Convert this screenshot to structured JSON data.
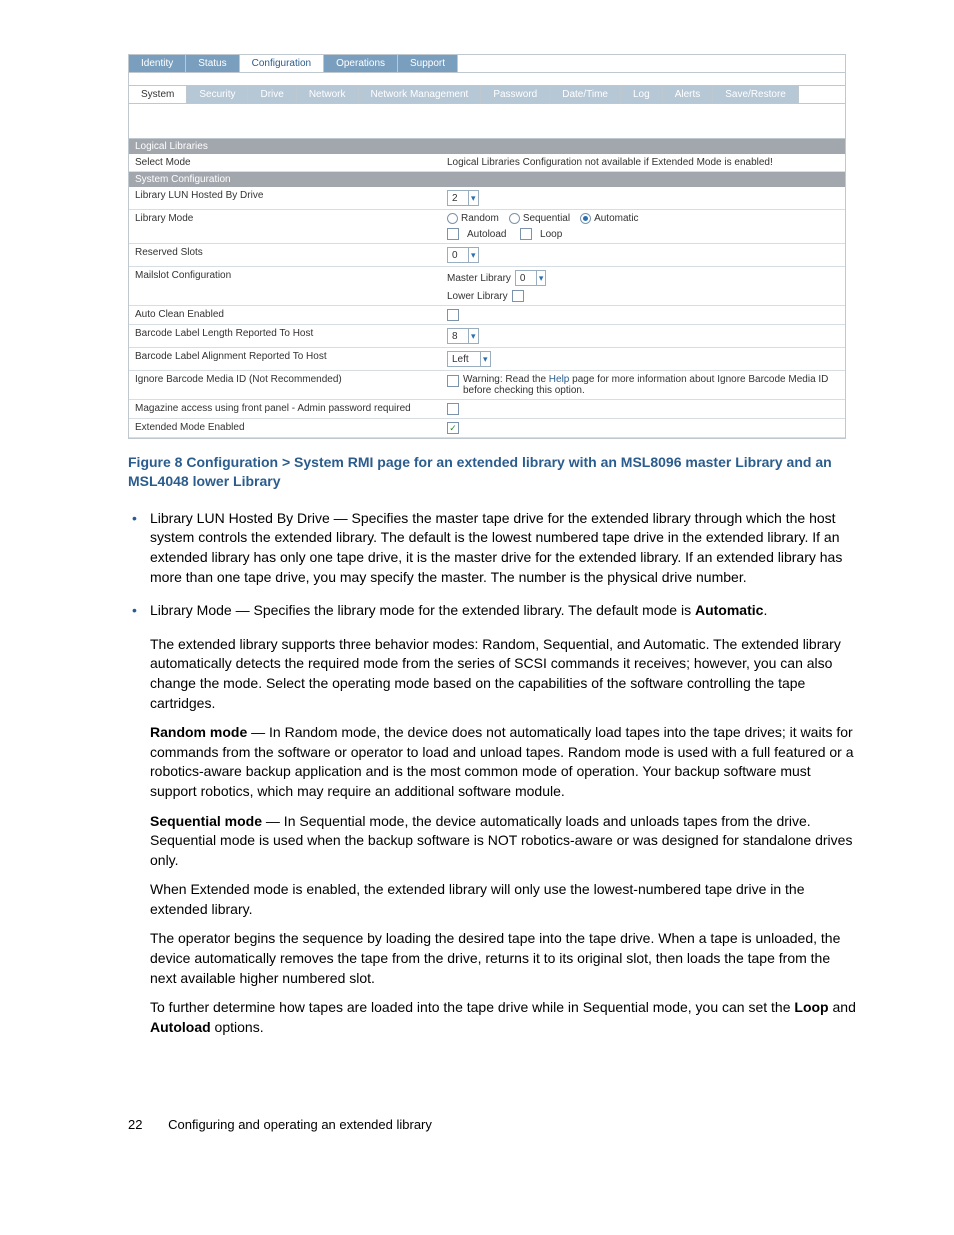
{
  "tabs_primary": [
    "Identity",
    "Status",
    "Configuration",
    "Operations",
    "Support"
  ],
  "tabs_primary_active_index": 2,
  "tabs_secondary": [
    "System",
    "Security",
    "Drive",
    "Network",
    "Network Management",
    "Password",
    "Date/Time",
    "Log",
    "Alerts",
    "Save/Restore"
  ],
  "tabs_secondary_active_index": 0,
  "section_headers": {
    "logical_libraries": "Logical Libraries",
    "system_configuration": "System Configuration"
  },
  "rows": {
    "select_mode": {
      "label": "Select Mode",
      "note": "Logical Libraries Configuration not available if Extended Mode is enabled!"
    },
    "library_lun": {
      "label": "Library LUN Hosted By Drive",
      "value": "2"
    },
    "library_mode": {
      "label": "Library Mode",
      "options": [
        "Random",
        "Sequential",
        "Automatic"
      ],
      "selected_index": 2,
      "checkboxes": [
        "Autoload",
        "Loop"
      ]
    },
    "reserved_slots": {
      "label": "Reserved Slots",
      "value": "0"
    },
    "mailslot": {
      "label": "Mailslot Configuration",
      "master_label": "Master Library",
      "master_value": "0",
      "lower_label": "Lower Library"
    },
    "auto_clean": {
      "label": "Auto Clean Enabled",
      "checked": false
    },
    "barcode_length": {
      "label": "Barcode Label Length Reported To Host",
      "value": "8"
    },
    "barcode_align": {
      "label": "Barcode Label Alignment Reported To Host",
      "value": "Left"
    },
    "ignore_barcode": {
      "label": "Ignore Barcode Media ID (Not Recommended)",
      "warning_pre": "Warning: Read the ",
      "help": "Help",
      "warning_post": " page for more information about Ignore Barcode Media ID before checking this option."
    },
    "magazine_access": {
      "label": "Magazine access using front panel - Admin password required",
      "checked": false
    },
    "extended_mode": {
      "label": "Extended Mode Enabled",
      "checked": true
    }
  },
  "figure_caption": "Figure 8 Configuration > System RMI page for an extended library with an MSL8096 master Library and an MSL4048 lower Library",
  "doc": {
    "li1": "Library LUN Hosted By Drive — Specifies the master tape drive for the extended library through which the host system controls the extended library. The default is the lowest numbered tape drive in the extended library. If an extended library has only one tape drive, it is the master drive for the extended library. If an extended library has more than one tape drive, you may specify the master. The number is the physical drive number.",
    "li2_a": "Library Mode — Specifies the library mode for the extended library. The default mode is ",
    "li2_b": "Automatic",
    "li2_c": ".",
    "p1": "The extended library supports three behavior modes: Random, Sequential, and Automatic. The extended library automatically detects the required mode from the series of SCSI commands it receives; however, you can also change the mode. Select the operating mode based on the capabilities of the software controlling the tape cartridges.",
    "p2_h": "Random mode",
    "p2": " — In Random mode, the device does not automatically load tapes into the tape drives; it waits for commands from the software or operator to load and unload tapes. Random mode is used with a full featured or a robotics-aware backup application and is the most common mode of operation. Your backup software must support robotics, which may require an additional software module.",
    "p3_h": "Sequential mode",
    "p3": " — In Sequential mode, the device automatically loads and unloads tapes from the drive. Sequential mode is used when the backup software is NOT robotics-aware or was designed for standalone drives only.",
    "p4": "When Extended mode is enabled, the extended library will only use the lowest-numbered tape drive in the extended library.",
    "p5": "The operator begins the sequence by loading the desired tape into the tape drive. When a tape is unloaded, the device automatically removes the tape from the drive, returns it to its original slot, then loads the tape from the next available higher numbered slot.",
    "p6_a": "To further determine how tapes are loaded into the tape drive while in Sequential mode, you can set the ",
    "p6_b": "Loop",
    "p6_c": " and ",
    "p6_d": "Autoload",
    "p6_e": " options."
  },
  "footer": {
    "page_number": "22",
    "page_title": "Configuring and operating an extended library"
  }
}
